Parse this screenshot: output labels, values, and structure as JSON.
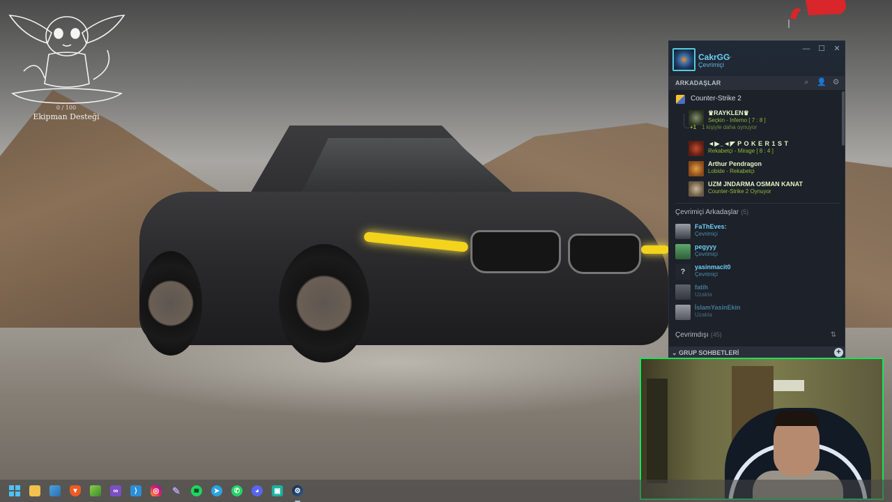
{
  "desktop": {
    "widget": {
      "count": "0 / 100",
      "title": "Ekipman Desteği"
    }
  },
  "steam": {
    "user": {
      "name": "CakrGG",
      "status": "Çevrimiçi"
    },
    "friends_section_title": "ARKADAŞLAR",
    "game_group": {
      "game": "Counter-Strike 2",
      "friends": [
        {
          "name": "♛RAYKLEN♛",
          "status": "Seçkin - Inferno [ 7 : 8 ]"
        },
        {
          "name": "◄▶_◄◤ P O K E R 1 S T",
          "status": "Rekabetçi - Mirage [ 8 : 4 ]"
        },
        {
          "name": "Arthur Pendragon",
          "status": "Lobide - Rekabetçi"
        },
        {
          "name": "UZM JNDARMA OSMAN KANAT",
          "status": "Counter-Strike 2 Oynuyor"
        }
      ],
      "more": {
        "plus": "+1",
        "text": "1 kişiyle daha oynuyor"
      }
    },
    "online_category": {
      "title": "Çevrimiçi Arkadaşlar",
      "count": "(5)"
    },
    "online_friends": [
      {
        "name": "FaThEves:",
        "status": "Çevrimiçi",
        "state": "online"
      },
      {
        "name": "pegyyy",
        "status": "Çevrimiçi",
        "state": "online"
      },
      {
        "name": "yasinmacit0",
        "status": "Çevrimiçi",
        "state": "online"
      },
      {
        "name": "fatih",
        "status": "Uzakta",
        "state": "away"
      },
      {
        "name": "İslamYasinEkin",
        "status": "Uzakta",
        "state": "away"
      }
    ],
    "offline_category": {
      "title": "Çevrimdışı",
      "count": "(45)"
    },
    "group_chats_title": "GRUP SOHBETLERİ"
  },
  "taskbar": {
    "apps": [
      "start-icon",
      "file-explorer-icon",
      "photos-icon",
      "brave-browser-icon",
      "notepad-icon",
      "visual-studio-icon",
      "vscode-icon",
      "instagram-icon",
      "pen-app-icon",
      "spotify-icon",
      "telegram-icon",
      "whatsapp-icon",
      "discord-icon",
      "android-app-icon",
      "steam-icon"
    ],
    "active": "steam-icon"
  },
  "colors": {
    "steam_online": "#6dcff6",
    "steam_ingame": "#90ba3c",
    "webcam_border": "#19e35a",
    "headlight": "#f3d31c"
  }
}
